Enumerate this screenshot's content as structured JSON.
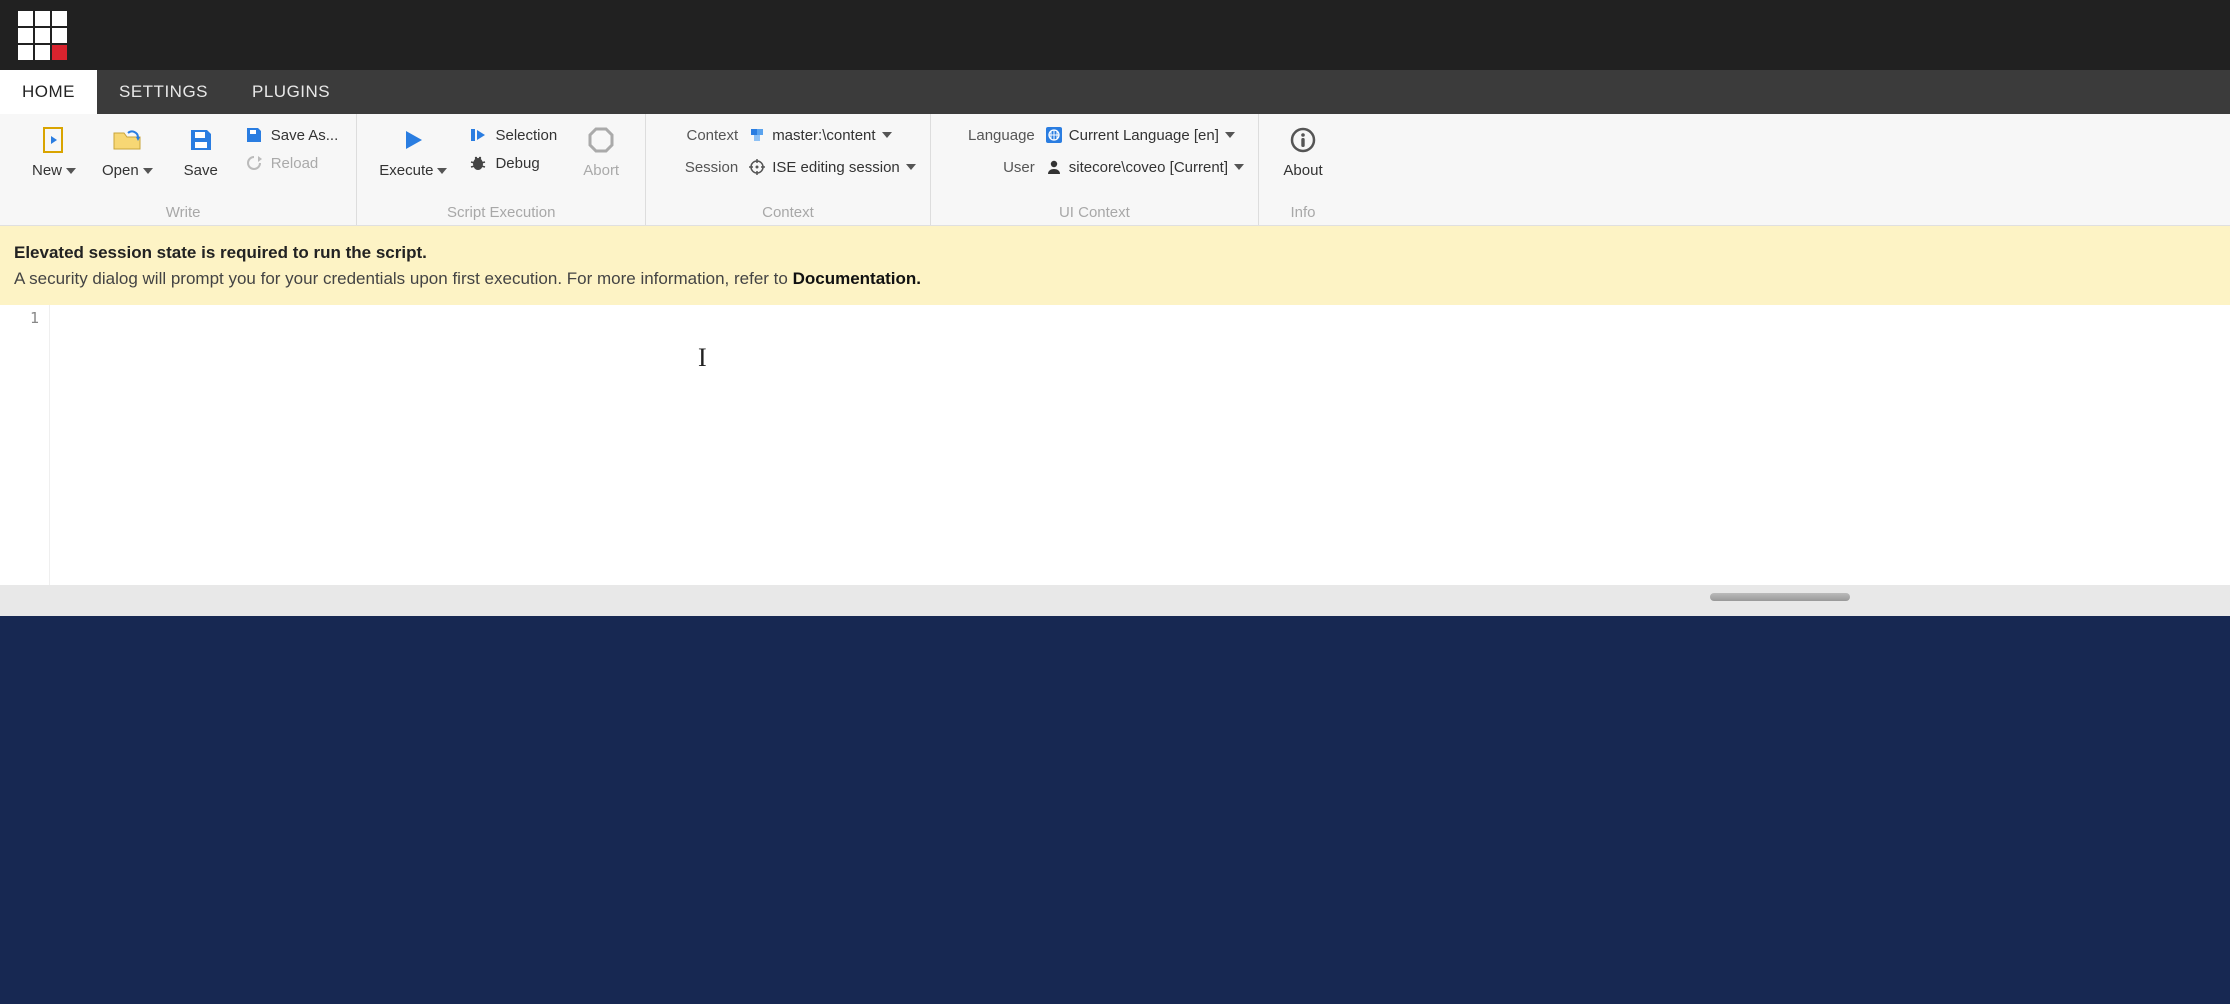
{
  "tabs": {
    "home": "HOME",
    "settings": "SETTINGS",
    "plugins": "PLUGINS"
  },
  "ribbon": {
    "write": {
      "new": "New",
      "open": "Open",
      "save": "Save",
      "save_as": "Save As...",
      "reload": "Reload",
      "group_label": "Write"
    },
    "exec": {
      "execute": "Execute",
      "selection": "Selection",
      "debug": "Debug",
      "abort": "Abort",
      "group_label": "Script Execution"
    },
    "context": {
      "context_label": "Context",
      "context_value": "master:\\content",
      "session_label": "Session",
      "session_value": "ISE editing session",
      "group_label": "Context"
    },
    "ui": {
      "language_label": "Language",
      "language_value": "Current Language [en]",
      "user_label": "User",
      "user_value": "sitecore\\coveo [Current]",
      "group_label": "UI Context"
    },
    "info": {
      "about": "About",
      "group_label": "Info"
    }
  },
  "banner": {
    "title": "Elevated session state is required to run the script.",
    "body_pre": "A security dialog will prompt you for your credentials upon first execution. For more information, refer to ",
    "doc": "Documentation."
  },
  "editor": {
    "line_number": "1"
  }
}
